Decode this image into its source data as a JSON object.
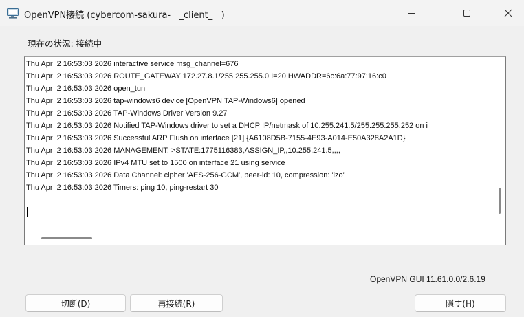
{
  "window": {
    "title": "OpenVPN接続 (cybercom-sakura-   _client_   )",
    "app_icon": "openvpn-monitor-icon",
    "controls": {
      "minimize_icon": "minimize-icon",
      "maximize_icon": "maximize-icon",
      "close_icon": "close-icon"
    }
  },
  "status": {
    "text": "現在の状況: 接続中"
  },
  "log": {
    "lines": [
      "Thu Apr  2 16:53:03 2026 interactive service msg_channel=676",
      "Thu Apr  2 16:53:03 2026 ROUTE_GATEWAY 172.27.8.1/255.255.255.0 I=20 HWADDR=6c:6a:77:97:16:c0",
      "Thu Apr  2 16:53:03 2026 open_tun",
      "Thu Apr  2 16:53:03 2026 tap-windows6 device [OpenVPN TAP-Windows6] opened",
      "Thu Apr  2 16:53:03 2026 TAP-Windows Driver Version 9.27",
      "Thu Apr  2 16:53:03 2026 Notified TAP-Windows driver to set a DHCP IP/netmask of 10.255.241.5/255.255.255.252 on i",
      "Thu Apr  2 16:53:03 2026 Successful ARP Flush on interface [21] {A6108D5B-7155-4E93-A014-E50A328A2A1D}",
      "Thu Apr  2 16:53:03 2026 MANAGEMENT: >STATE:1775116383,ASSIGN_IP,,10.255.241.5,,,,",
      "Thu Apr  2 16:53:03 2026 IPv4 MTU set to 1500 on interface 21 using service",
      "Thu Apr  2 16:53:03 2026 Data Channel: cipher 'AES-256-GCM', peer-id: 10, compression: 'lzo'",
      "Thu Apr  2 16:53:03 2026 Timers: ping 10, ping-restart 30"
    ]
  },
  "footer": {
    "version": "OpenVPN GUI 11.61.0.0/2.6.19",
    "buttons": {
      "disconnect": "切断(D)",
      "reconnect": "再接続(R)",
      "hide": "隠す(H)"
    }
  }
}
